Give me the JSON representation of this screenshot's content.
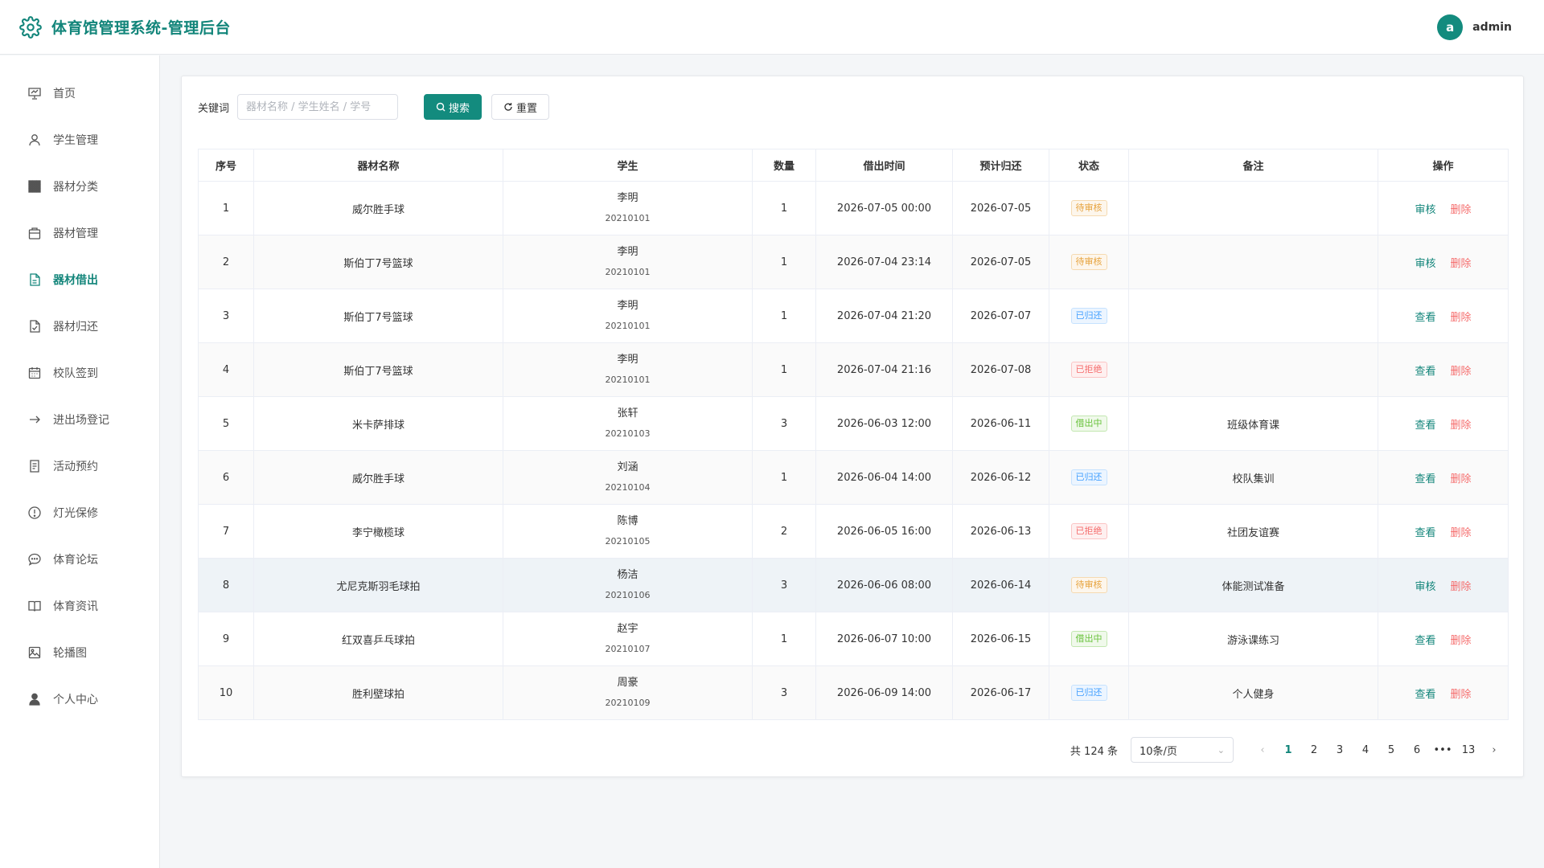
{
  "header": {
    "title": "体育馆管理系统-管理后台",
    "avatar_letter": "a",
    "username": "admin"
  },
  "sidebar": {
    "items": [
      {
        "label": "首页",
        "icon": "presentation-icon"
      },
      {
        "label": "学生管理",
        "icon": "user-icon"
      },
      {
        "label": "器材分类",
        "icon": "grid-icon"
      },
      {
        "label": "器材管理",
        "icon": "box-icon"
      },
      {
        "label": "器材借出",
        "icon": "document-icon",
        "active": true
      },
      {
        "label": "器材归还",
        "icon": "document-check-icon"
      },
      {
        "label": "校队签到",
        "icon": "calendar-icon"
      },
      {
        "label": "进出场登记",
        "icon": "arrow-right-icon"
      },
      {
        "label": "活动预约",
        "icon": "list-icon"
      },
      {
        "label": "灯光保修",
        "icon": "warning-icon"
      },
      {
        "label": "体育论坛",
        "icon": "chat-icon"
      },
      {
        "label": "体育资讯",
        "icon": "book-icon"
      },
      {
        "label": "轮播图",
        "icon": "image-icon"
      },
      {
        "label": "个人中心",
        "icon": "person-icon"
      }
    ]
  },
  "search": {
    "label": "关键词",
    "placeholder": "器材名称 / 学生姓名 / 学号",
    "value": "",
    "search_button": "搜索",
    "reset_button": "重置"
  },
  "table": {
    "headers": [
      "序号",
      "器材名称",
      "学生",
      "数量",
      "借出时间",
      "预计归还",
      "状态",
      "备注",
      "操作"
    ],
    "rows": [
      {
        "no": "1",
        "equipment": "威尔胜手球",
        "student": "李明",
        "student_no": "20210101",
        "qty": "1",
        "borrow_time": "2026-07-05 00:00",
        "return_date": "2026-07-05",
        "status": "待审核",
        "status_type": "warn",
        "remark": "",
        "action": "审核",
        "delete": "删除"
      },
      {
        "no": "2",
        "equipment": "斯伯丁7号篮球",
        "student": "李明",
        "student_no": "20210101",
        "qty": "1",
        "borrow_time": "2026-07-04 23:14",
        "return_date": "2026-07-05",
        "status": "待审核",
        "status_type": "warn",
        "remark": "",
        "action": "审核",
        "delete": "删除"
      },
      {
        "no": "3",
        "equipment": "斯伯丁7号篮球",
        "student": "李明",
        "student_no": "20210101",
        "qty": "1",
        "borrow_time": "2026-07-04 21:20",
        "return_date": "2026-07-07",
        "status": "已归还",
        "status_type": "info",
        "remark": "",
        "action": "查看",
        "delete": "删除"
      },
      {
        "no": "4",
        "equipment": "斯伯丁7号篮球",
        "student": "李明",
        "student_no": "20210101",
        "qty": "1",
        "borrow_time": "2026-07-04 21:16",
        "return_date": "2026-07-08",
        "status": "已拒绝",
        "status_type": "danger",
        "remark": "",
        "action": "查看",
        "delete": "删除"
      },
      {
        "no": "5",
        "equipment": "米卡萨排球",
        "student": "张轩",
        "student_no": "20210103",
        "qty": "3",
        "borrow_time": "2026-06-03 12:00",
        "return_date": "2026-06-11",
        "status": "借出中",
        "status_type": "success",
        "remark": "班级体育课",
        "action": "查看",
        "delete": "删除"
      },
      {
        "no": "6",
        "equipment": "威尔胜手球",
        "student": "刘涵",
        "student_no": "20210104",
        "qty": "1",
        "borrow_time": "2026-06-04 14:00",
        "return_date": "2026-06-12",
        "status": "已归还",
        "status_type": "info",
        "remark": "校队集训",
        "action": "查看",
        "delete": "删除"
      },
      {
        "no": "7",
        "equipment": "李宁橄榄球",
        "student": "陈博",
        "student_no": "20210105",
        "qty": "2",
        "borrow_time": "2026-06-05 16:00",
        "return_date": "2026-06-13",
        "status": "已拒绝",
        "status_type": "danger",
        "remark": "社团友谊赛",
        "action": "查看",
        "delete": "删除"
      },
      {
        "no": "8",
        "equipment": "尤尼克斯羽毛球拍",
        "student": "杨洁",
        "student_no": "20210106",
        "qty": "3",
        "borrow_time": "2026-06-06 08:00",
        "return_date": "2026-06-14",
        "status": "待审核",
        "status_type": "warn",
        "remark": "体能测试准备",
        "action": "审核",
        "delete": "删除"
      },
      {
        "no": "9",
        "equipment": "红双喜乒乓球拍",
        "student": "赵宇",
        "student_no": "20210107",
        "qty": "1",
        "borrow_time": "2026-06-07 10:00",
        "return_date": "2026-06-15",
        "status": "借出中",
        "status_type": "success",
        "remark": "游泳课练习",
        "action": "查看",
        "delete": "删除"
      },
      {
        "no": "10",
        "equipment": "胜利壁球拍",
        "student": "周豪",
        "student_no": "20210109",
        "qty": "3",
        "borrow_time": "2026-06-09 14:00",
        "return_date": "2026-06-17",
        "status": "已归还",
        "status_type": "info",
        "remark": "个人健身",
        "action": "查看",
        "delete": "删除"
      }
    ]
  },
  "pagination": {
    "total_text": "共 124 条",
    "page_size": "10条/页",
    "pages": [
      "1",
      "2",
      "3",
      "4",
      "5",
      "6",
      "•••",
      "13"
    ],
    "current": "1"
  },
  "colors": {
    "accent": "#138b7e",
    "danger": "#f56c6c",
    "warning": "#e6a23c",
    "info": "#409eff",
    "success": "#67c23a"
  }
}
